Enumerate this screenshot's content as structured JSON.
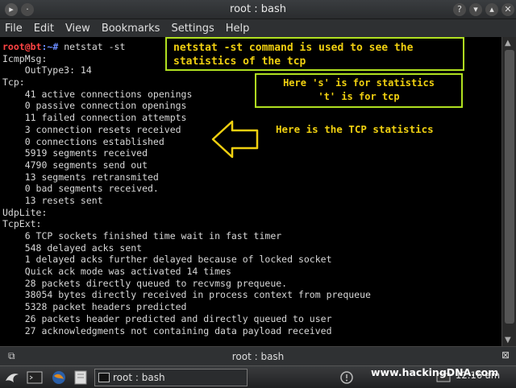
{
  "window": {
    "title": "root : bash"
  },
  "menu": [
    "File",
    "Edit",
    "View",
    "Bookmarks",
    "Settings",
    "Help"
  ],
  "prompt": {
    "user": "root",
    "at": "@",
    "host": "bt",
    "path": ":~",
    "symbol": "# ",
    "command": "netstat -st"
  },
  "output_lines": [
    "IcmpMsg:",
    "    OutType3: 14",
    "Tcp:",
    "    41 active connections openings",
    "    0 passive connection openings",
    "    11 failed connection attempts",
    "    3 connection resets received",
    "    0 connections established",
    "    5919 segments received",
    "    4790 segments send out",
    "    13 segments retransmited",
    "    0 bad segments received.",
    "    13 resets sent",
    "UdpLite:",
    "TcpExt:",
    "    6 TCP sockets finished time wait in fast timer",
    "    548 delayed acks sent",
    "    1 delayed acks further delayed because of locked socket",
    "    Quick ack mode was activated 14 times",
    "    28 packets directly queued to recvmsg prequeue.",
    "    38054 bytes directly received in process context from prequeue",
    "    5328 packet headers predicted",
    "    26 packets header predicted and directly queued to user",
    "    27 acknowledgments not containing data payload received"
  ],
  "annotations": {
    "box1_line1": "netstat -st command is used to see the",
    "box1_line2": "statistics of the tcp",
    "box2_line1": "Here 's' is for statistics",
    "box2_line2": "'t' is for tcp",
    "label": "Here is the TCP statistics"
  },
  "tabbar": {
    "title": "root : bash"
  },
  "taskbar": {
    "task_label": "root : bash",
    "watermark": "www.hackingDNA.com",
    "clock": "12:16 am"
  },
  "colors": {
    "annotation_border": "#b0e020",
    "annotation_text": "#f0d010",
    "prompt_user": "#ff4444",
    "prompt_path": "#6a8cff"
  }
}
